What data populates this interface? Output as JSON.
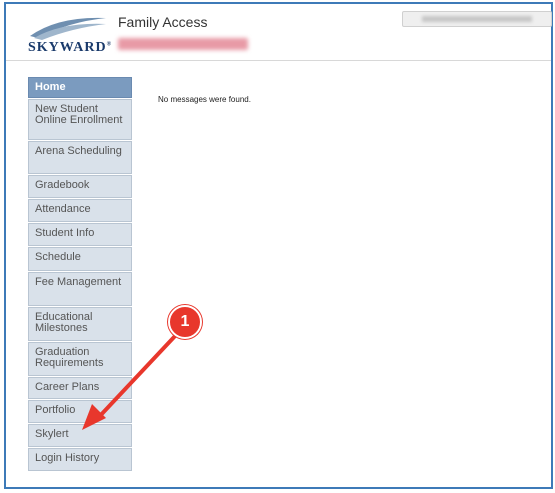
{
  "header": {
    "logo_text": "SKYWARD",
    "logo_mark": "®",
    "app_title": "Family Access"
  },
  "sidebar": {
    "items": [
      {
        "label": "Home",
        "active": true
      },
      {
        "label": "New Student Online Enrollment"
      },
      {
        "label": "Arena Scheduling"
      },
      {
        "label": "Gradebook"
      },
      {
        "label": "Attendance"
      },
      {
        "label": "Student Info"
      },
      {
        "label": "Schedule"
      },
      {
        "label": "Fee Management"
      },
      {
        "label": "Educational Milestones"
      },
      {
        "label": "Graduation Requirements"
      },
      {
        "label": "Career Plans"
      },
      {
        "label": "Portfolio"
      },
      {
        "label": "Skylert"
      },
      {
        "label": "Login History"
      }
    ]
  },
  "main": {
    "message": "No messages were found."
  },
  "annotation": {
    "step_number": "1",
    "color": "#e8372c"
  }
}
